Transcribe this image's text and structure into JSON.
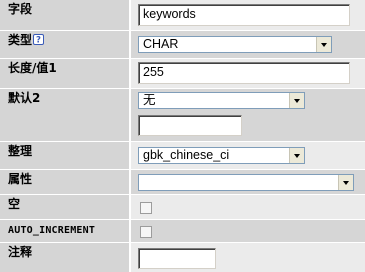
{
  "colors": {
    "label_bg": "#d5d5d5",
    "value_bg_light": "#ebebeb",
    "value_bg_dark": "#d6d6d6",
    "help_icon": "#3a5bb8"
  },
  "fields": {
    "name": {
      "label": "字段",
      "value": "keywords"
    },
    "type": {
      "label": "类型",
      "selected": "CHAR",
      "help_icon": "help-icon"
    },
    "length": {
      "label": "长度/值1",
      "value": "255"
    },
    "default": {
      "label": "默认2",
      "selected": "无",
      "value": ""
    },
    "collation": {
      "label": "整理",
      "selected": "gbk_chinese_ci"
    },
    "attributes": {
      "label": "属性",
      "selected": ""
    },
    "null": {
      "label": "空",
      "checked": false
    },
    "auto_increment": {
      "label": "AUTO_INCREMENT",
      "checked": false
    },
    "comment": {
      "label": "注释",
      "value": ""
    }
  }
}
